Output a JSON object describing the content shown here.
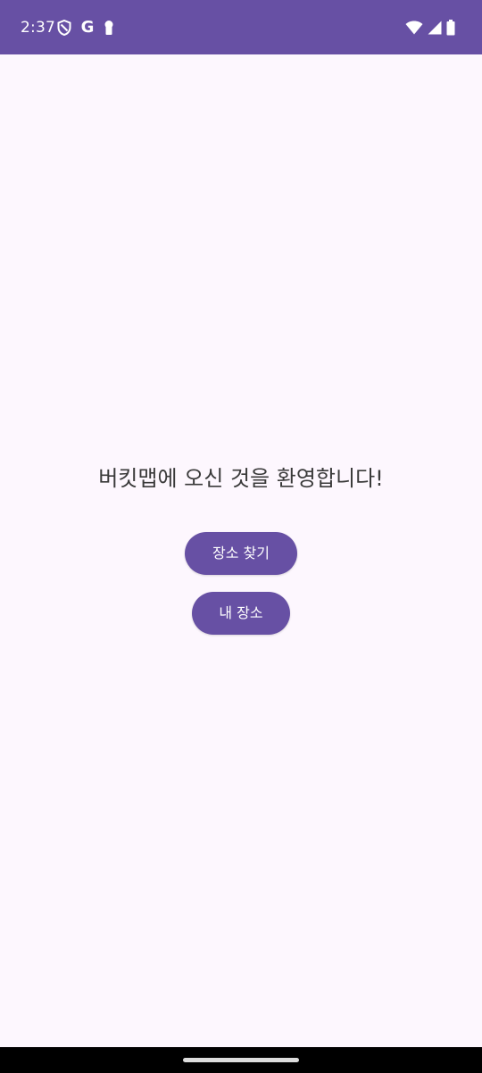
{
  "status_bar": {
    "time": "2:37",
    "icons_left": [
      "vpn-shield-icon",
      "google-icon",
      "keyhole-icon"
    ],
    "google_letter": "G",
    "icons_right": [
      "wifi-icon",
      "cellular-signal-icon",
      "battery-icon"
    ],
    "background_color": "#6750a4"
  },
  "main": {
    "welcome_text": "버킷맵에 오신 것을 환영합니다!",
    "buttons": [
      {
        "label": "장소 찾기"
      },
      {
        "label": "내 장소"
      }
    ],
    "accent_color": "#6750a4",
    "background_color": "#fdf7fe"
  },
  "nav_bar": {
    "background_color": "#000000"
  }
}
